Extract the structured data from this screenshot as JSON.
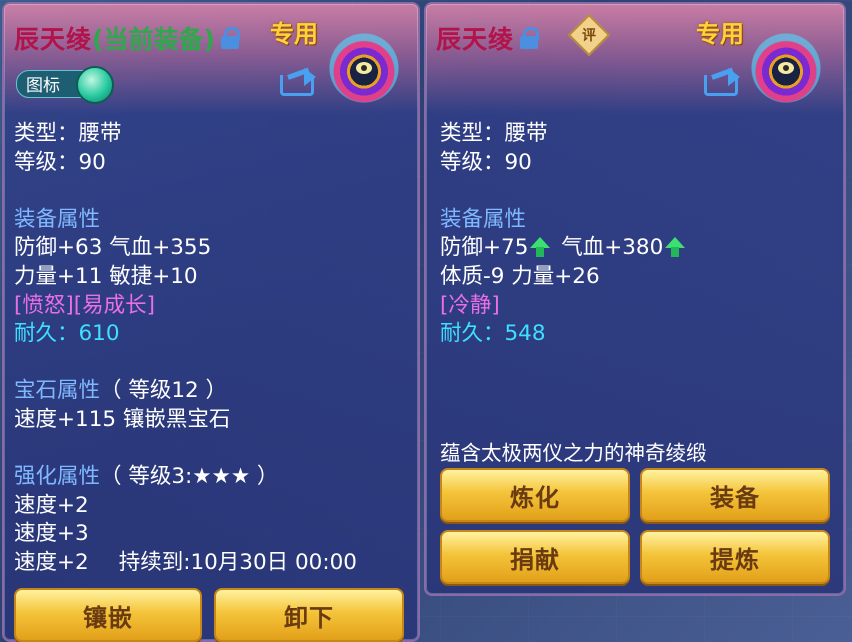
{
  "left_panel": {
    "title": "辰天绫",
    "equipped_tag": "(当前装备)",
    "special_tag": "专用",
    "toggle_label": "图标",
    "type": "类型：腰带",
    "level": "等级：90",
    "attr_header": "装备属性",
    "attr_line1": "防御+63 气血+355",
    "attr_line2": "力量+11 敏捷+10",
    "special_attrs": "[愤怒][易成长]",
    "durability": "耐久：610",
    "gem_header": "宝石属性",
    "gem_level": "（ 等级12 ）",
    "gem_line": "速度+115 镶嵌黑宝石",
    "enhance_header": "强化属性",
    "enhance_level": "（ 等级3:★★★ ）",
    "enhance_line1": "速度+2",
    "enhance_line2": "速度+3",
    "enhance_line3": "速度+2",
    "expire": "持续到:10月30日 00:00",
    "buttons": {
      "inlay": "镶嵌",
      "unequip": "卸下"
    }
  },
  "right_panel": {
    "title": "辰天绫",
    "rate_badge": "评",
    "special_tag": "专用",
    "type": "类型：腰带",
    "level": "等级：90",
    "attr_header": "装备属性",
    "attr_line1_a": "防御+75",
    "attr_line1_b": "气血+380",
    "attr_line2": "体质-9 力量+26",
    "special_attrs": "[冷静]",
    "durability": "耐久：548",
    "description": "蕴含太极两仪之力的神奇绫缎",
    "buttons": {
      "refine": "炼化",
      "equip": "装备",
      "donate": "捐献",
      "extract": "提炼"
    }
  },
  "colors": {
    "title": "#b2134a",
    "equipped": "#2ea84a",
    "special": "#ffd23a",
    "section_header": "#7fb8ff",
    "special_attr": "#e86fe8",
    "durability": "#3ee0ff",
    "upgrade_arrow": "#3ce070",
    "button": "#f4c43a"
  }
}
